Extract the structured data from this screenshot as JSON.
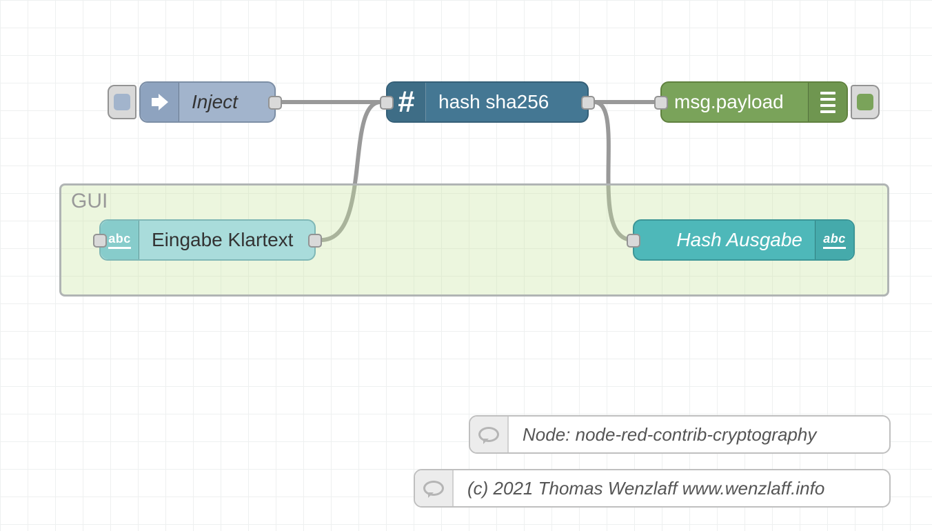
{
  "group": {
    "label": "GUI"
  },
  "nodes": {
    "inject": {
      "label": "Inject"
    },
    "hash": {
      "label": "hash sha256"
    },
    "debug": {
      "label": "msg.payload"
    },
    "ui_in": {
      "label": "Eingabe Klartext"
    },
    "ui_out": {
      "label": "Hash Ausgabe"
    }
  },
  "comments": {
    "c1": "Node: node-red-contrib-cryptography",
    "c2": "(c) 2021 Thomas Wenzlaff www.wenzlaff.info"
  },
  "colors": {
    "inject_btn": "#a2b4cc",
    "debug_btn": "#7aa35a"
  }
}
